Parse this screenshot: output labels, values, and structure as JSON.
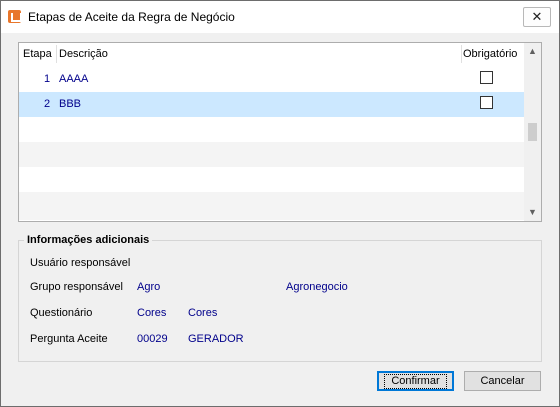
{
  "window": {
    "title": "Etapas de Aceite da Regra de Negócio",
    "close_symbol": "✕"
  },
  "grid": {
    "columns": [
      "Etapa",
      "Descrição",
      "Obrigatório"
    ],
    "rows": [
      {
        "etapa": "1",
        "descricao": "AAAA",
        "obrigatorio": false,
        "selected": false
      },
      {
        "etapa": "2",
        "descricao": "BBB",
        "obrigatorio": false,
        "selected": true
      }
    ],
    "scroll_up": "▲",
    "scroll_down": "▼"
  },
  "info": {
    "legend": "Informações adicionais",
    "usuario_label": "Usuário responsável",
    "grupo_label": "Grupo responsável",
    "grupo_code": "Agro",
    "grupo_name": "Agronegocio",
    "questionario_label": "Questionário",
    "questionario_code": "Cores",
    "questionario_name": "Cores",
    "pergunta_label": "Pergunta Aceite",
    "pergunta_code": "00029",
    "pergunta_name": "GERADOR"
  },
  "buttons": {
    "confirm": "Confirmar",
    "cancel": "Cancelar"
  },
  "colors": {
    "selected_row": "#cce8ff",
    "value_text": "#00008b",
    "alt_row": "#f4f4f4"
  }
}
